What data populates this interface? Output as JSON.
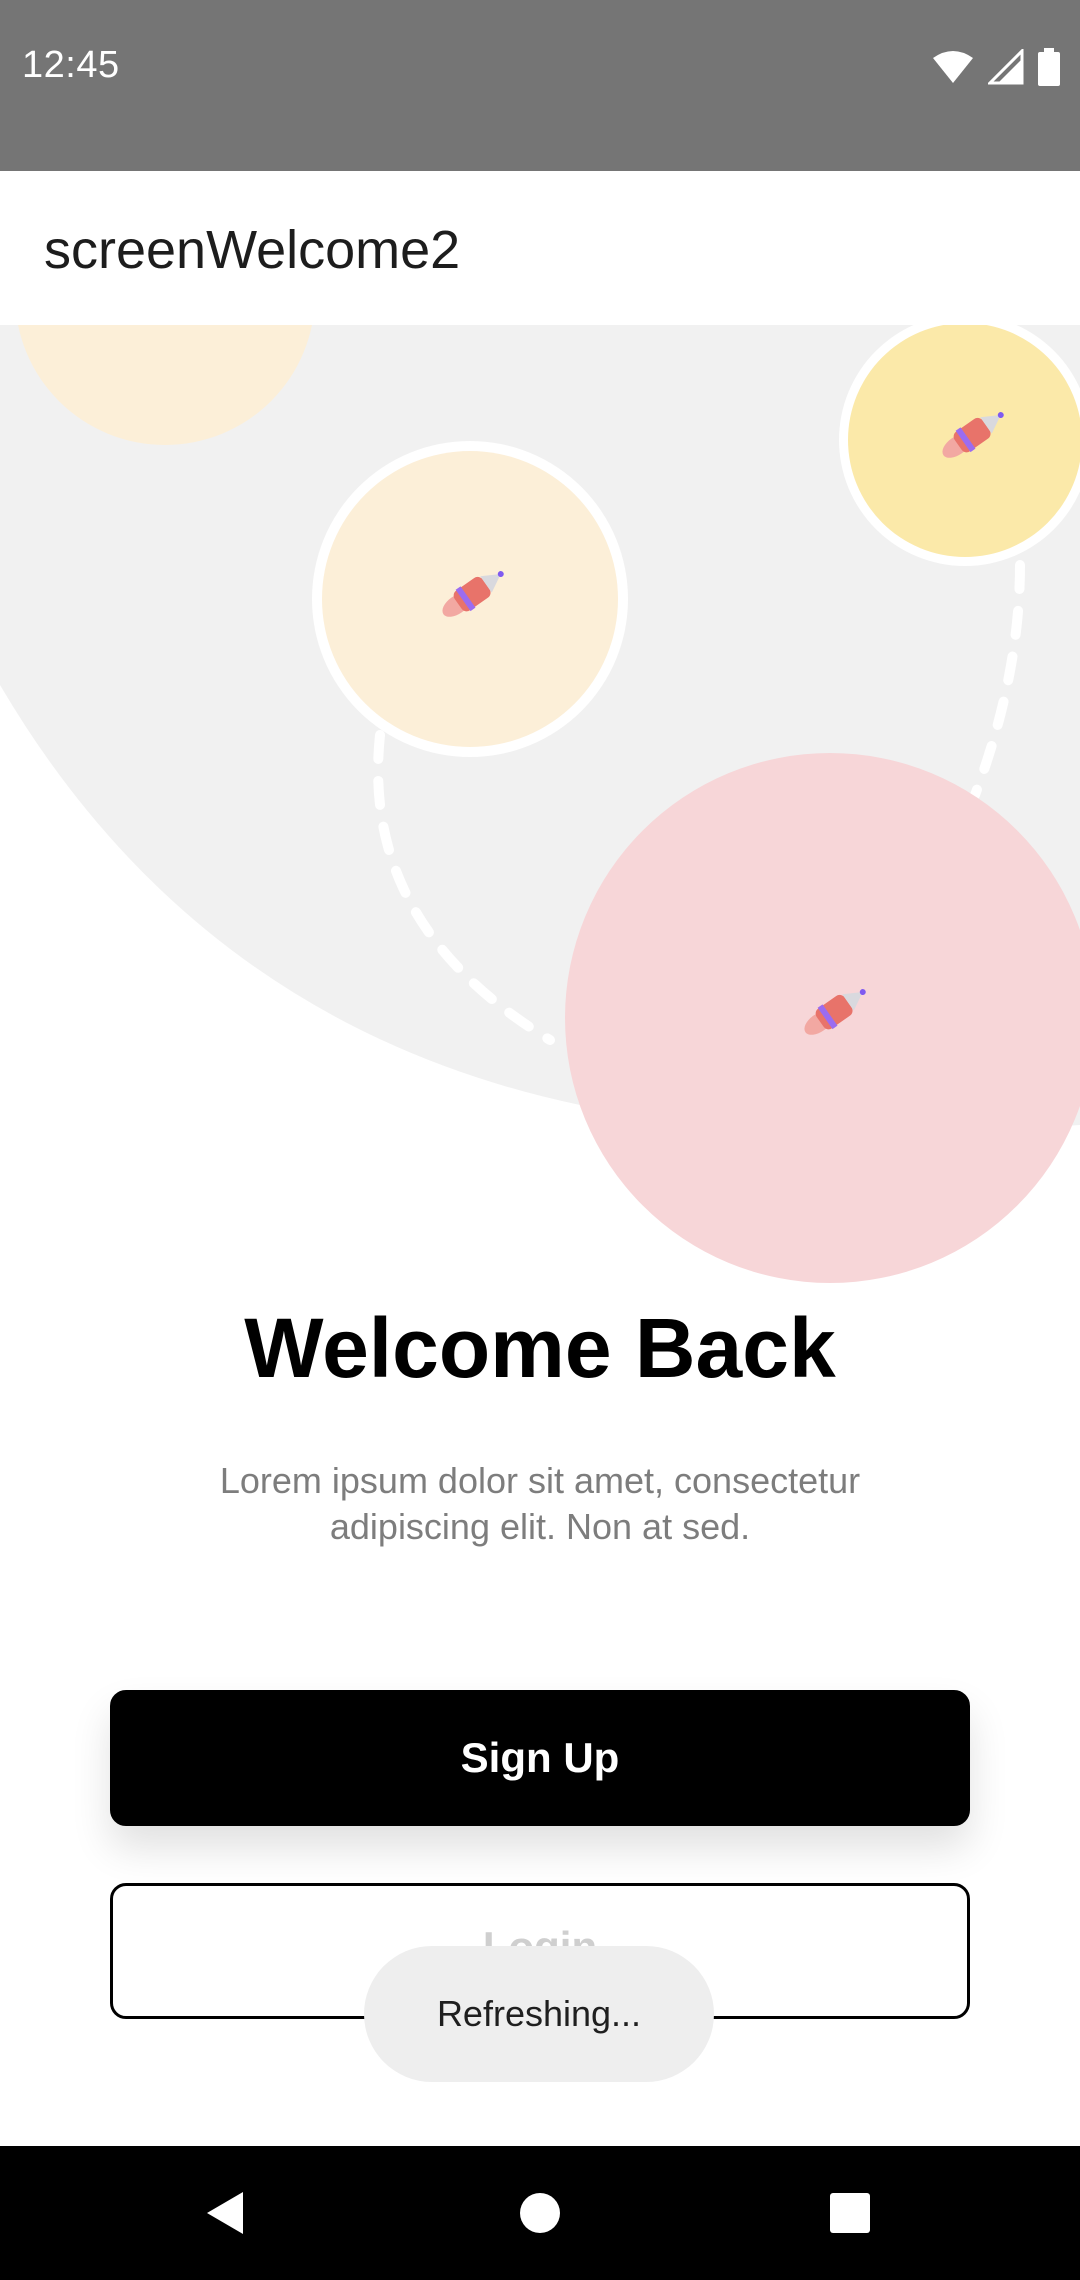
{
  "status_bar": {
    "time": "12:45",
    "icons": [
      "wifi-icon",
      "signal-icon",
      "battery-icon"
    ]
  },
  "app_bar": {
    "title": "screenWelcome2"
  },
  "hero": {
    "icon": "rocket-icon",
    "colors": {
      "background_blob": "#f1f1f1",
      "planet_peach": "#fcefd8",
      "planet_yellow": "#fbe9a9",
      "planet_pink": "#f7d6d8"
    }
  },
  "content": {
    "title": "Welcome Back",
    "subtitle_line1": "Lorem ipsum dolor sit amet, consectetur",
    "subtitle_line2": "adipiscing elit. Non at sed."
  },
  "buttons": {
    "signup_label": "Sign Up",
    "login_label": "Login"
  },
  "toast": {
    "message": "Refreshing..."
  },
  "nav_bar": {
    "icons": [
      "back-icon",
      "home-icon",
      "recents-icon"
    ]
  }
}
